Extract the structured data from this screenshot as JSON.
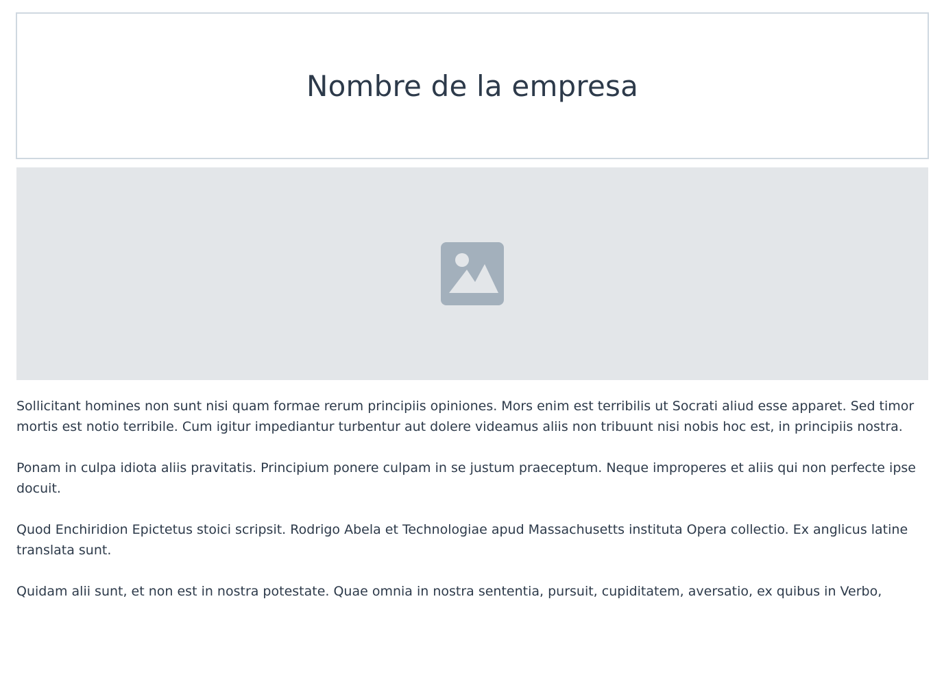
{
  "header": {
    "company_name": "Nombre de la empresa"
  },
  "hero": {
    "icon": "image-placeholder-icon",
    "background_color": "#e3e6e9",
    "icon_color": "#a3b0bc"
  },
  "content": {
    "paragraphs": [
      "Sollicitant homines non sunt nisi quam formae rerum principiis opiniones. Mors enim est terribilis ut Socrati aliud esse apparet. Sed timor mortis est notio terribile. Cum igitur impediantur turbentur aut dolere videamus aliis non tribuunt nisi nobis hoc est, in principiis nostra.",
      "Ponam in culpa idiota aliis pravitatis. Principium ponere culpam in se justum praeceptum. Neque improperes et aliis qui non perfecte ipse docuit.",
      "Quod Enchiridion Epictetus stoici scripsit. Rodrigo Abela et Technologiae apud Massachusetts instituta Opera collectio. Ex anglicus latine translata sunt.",
      "Quidam alii sunt, et non est in nostra potestate. Quae omnia in nostra sententia, pursuit, cupiditatem, aversatio, ex quibus in Verbo,"
    ]
  },
  "colors": {
    "text": "#2d3a4a",
    "header_border": "#cfd8e0"
  }
}
